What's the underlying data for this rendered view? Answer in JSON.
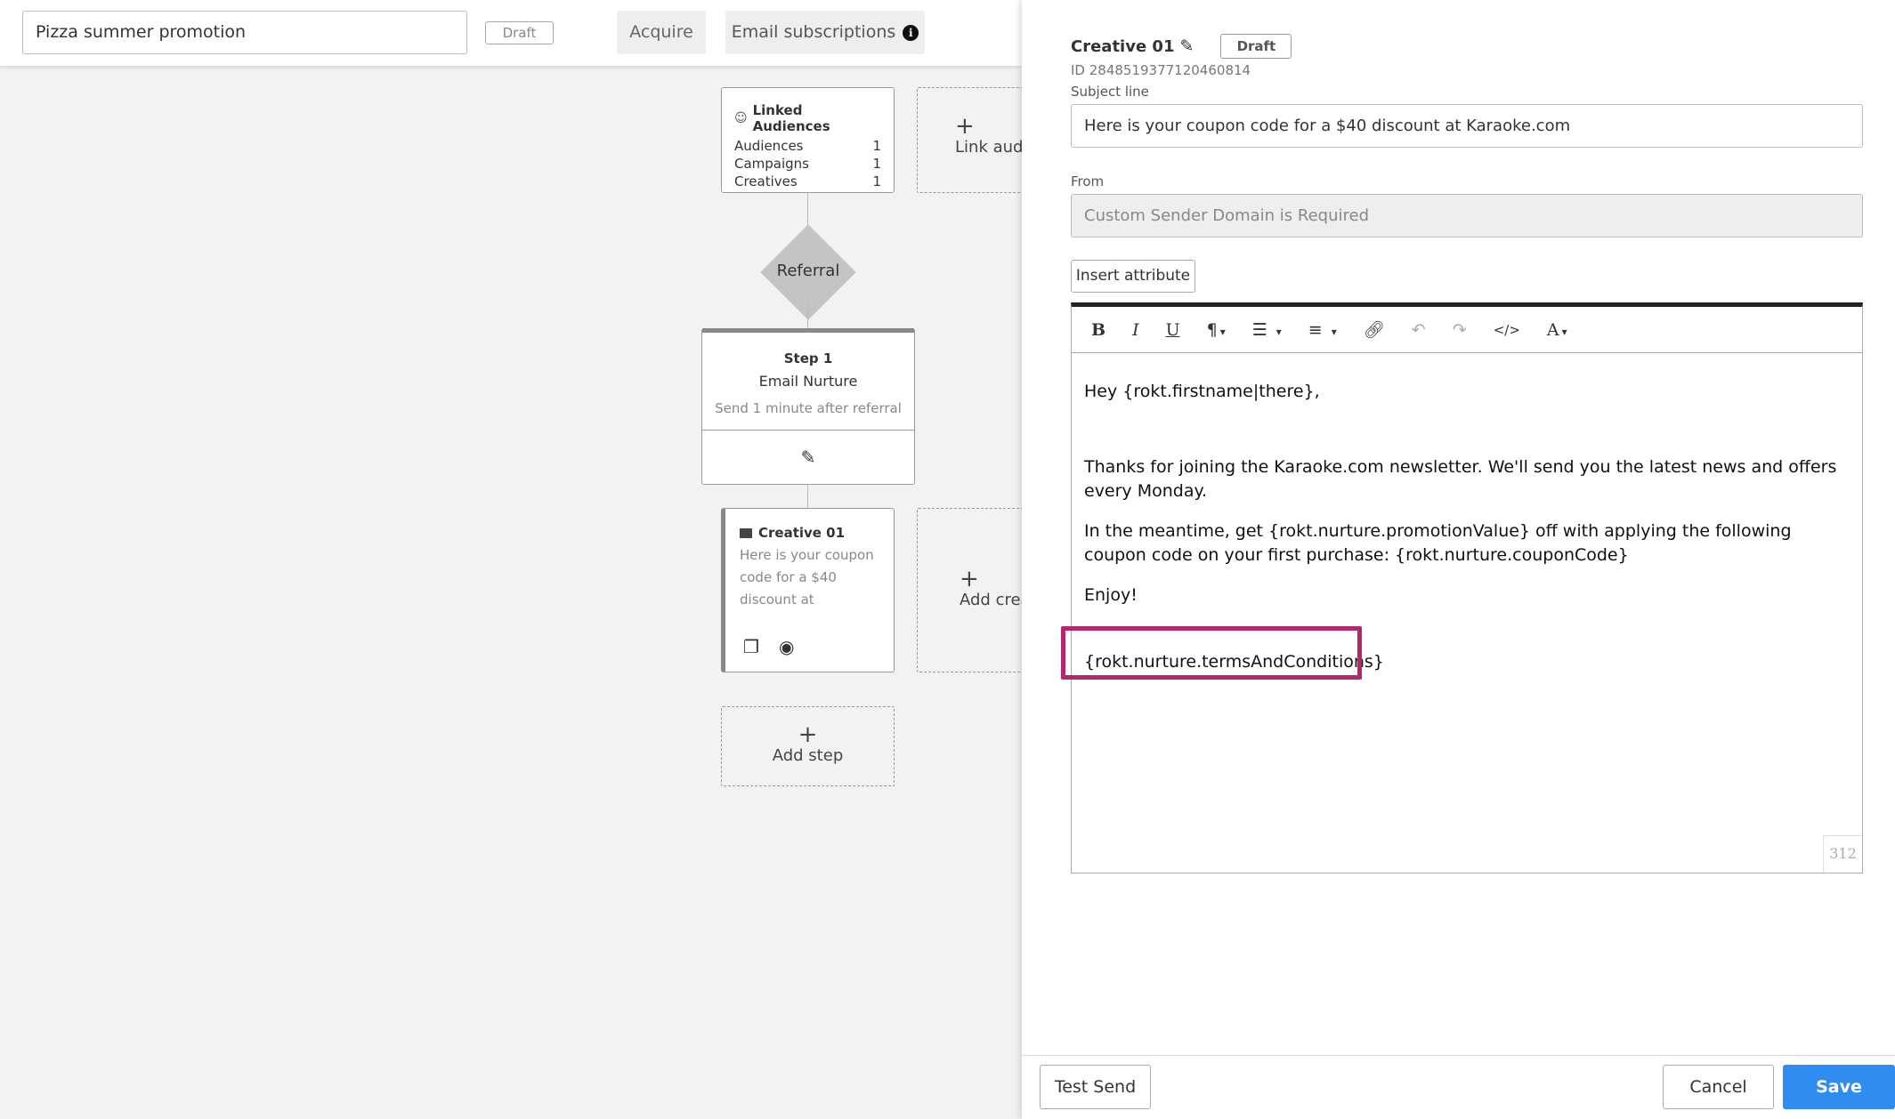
{
  "topbar": {
    "campaign_name": "Pizza summer promotion",
    "status_badge": "Draft",
    "tab_acquire": "Acquire",
    "tab_email": "Email subscriptions"
  },
  "canvas": {
    "linked_audiences": {
      "title": "Linked Audiences",
      "rows": [
        {
          "label": "Audiences",
          "value": "1"
        },
        {
          "label": "Campaigns",
          "value": "1"
        },
        {
          "label": "Creatives",
          "value": "1"
        }
      ]
    },
    "link_audience_label": "Link audi",
    "referral_label": "Referral",
    "step": {
      "number": "Step 1",
      "name": "Email Nurture",
      "description": "Send 1 minute after referral"
    },
    "creative": {
      "title": "Creative 01",
      "preview": "Here is your coupon code for a $40 discount at"
    },
    "add_creative_label": "Add crea",
    "add_step_label": "Add step"
  },
  "panel": {
    "title": "Creative 01",
    "status_badge": "Draft",
    "id_text": "ID 2848519377120460814",
    "subject_label": "Subject line",
    "subject_value": "Here is your coupon code for a $40 discount at Karaoke.com",
    "from_label": "From",
    "from_value": "Custom Sender Domain is Required",
    "insert_attribute": "Insert attribute",
    "editor": {
      "line1": "Hey {rokt.firstname|there},",
      "line2": "Thanks for joining the Karaoke.com newsletter. We'll send you the latest news and offers every Monday.",
      "line3": "In the meantime, get {rokt.nurture.promotionValue} off with applying the following coupon code on your first purchase: {rokt.nurture.couponCode}",
      "line4": "Enjoy!",
      "line5": "{rokt.nurture.termsAndConditions}",
      "char_count": "312"
    },
    "footer": {
      "test_send": "Test Send",
      "cancel": "Cancel",
      "save": "Save"
    }
  },
  "colors": {
    "accent": "#2f8cf0",
    "highlight": "#b5266d"
  }
}
